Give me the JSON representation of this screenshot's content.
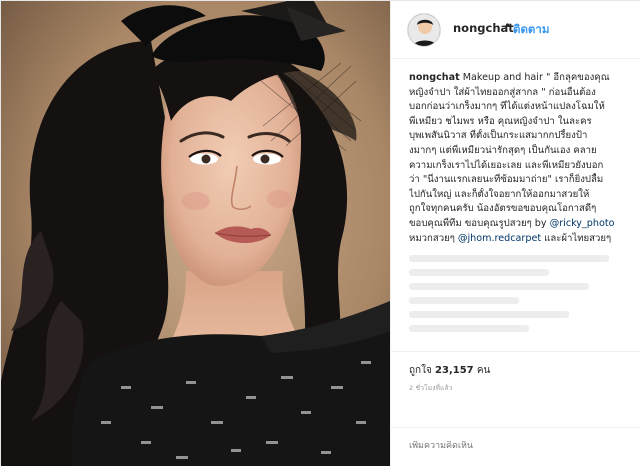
{
  "post": {
    "username": "nongchat",
    "separator": "•",
    "follow_label": "ติดตาม",
    "caption": {
      "username": "nongchat",
      "lines": [
        " Makeup and hair \" อีกลุคของคุณ",
        "หญิงจำปา ใส่ผ้าไทยออกสู่สากล \" ก่อนอื่นต้อง",
        "บอกก่อนว่าเกร็งมากๆ ที่ได้แต่งหน้าแปลงโฉมให้",
        "พี่เหมียว ชไมพร หรือ คุณหญิงจำปา ในละคร",
        "บุพเพสันนิวาส ที่ตั้งเป็นกระแสมากกปรี้ยงป้า",
        "งมากๆ แต่พี่เหมียวน่ารักสุดๆ เป็นกันเอง คลาย",
        "ความเกร็งเราไปได้เยอะเลย และพี่เหมียวยังบอก",
        "ว่า \"นี่งานแรกเลยนะที่ซ้อมมาถ่าย\" เราก็ยิ่งปลื้ม",
        "ไปกันใหญ่ และก็ตั้งใจอยากให้ออกมาสวยให้",
        "ถูกใจทุกคนครับ น้องอัตรขอขอบคุณโอกาสดีๆ"
      ],
      "line_thanks_prefix": "ขอบคุณพี่ทีม ขอบคุณรูปสวยๆ by ",
      "mention_photo": "@ricky_photo",
      "line_dress_prefix": "หมวกสวยๆ ",
      "mention_dress": "@jhom.redcarpet",
      "line_dress_suffix": " และผ้าไทยสวยๆ"
    },
    "likes_prefix": "ถูกใจ",
    "likes_count": "23,157",
    "likes_suffix": "คน",
    "timestamp": "2 ชั่วโมงที่แล้ว",
    "add_comment_placeholder": "เพิ่มความคิดเห็น"
  },
  "colors": {
    "link": "#3897f0",
    "mention": "#003569",
    "background": "#ffffff"
  },
  "icons": {
    "avatar": "profile-avatar"
  }
}
